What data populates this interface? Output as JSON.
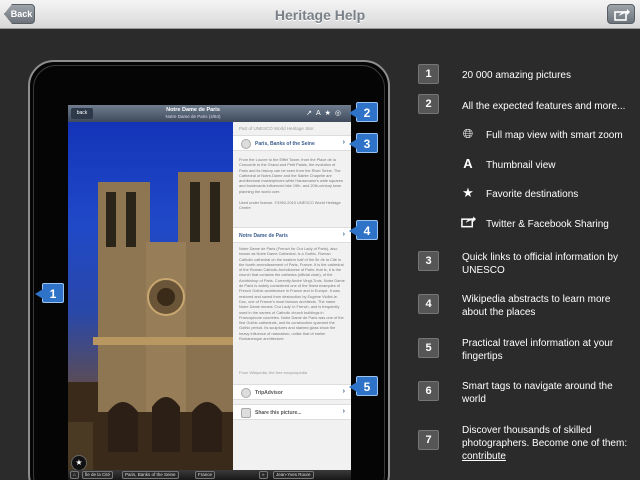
{
  "nav": {
    "back_label": "Back",
    "title": "Heritage Help"
  },
  "app": {
    "back_label": "back",
    "title": "Notre Dame de Paris",
    "subtitle": "Notre Dame de Paris (4/84)",
    "panel": {
      "heading": "Part of UNESCO World Heritage Site:",
      "unesco_label": "Paris, Banks of the Seine",
      "unesco_text": "From the Louvre to the Eiffel Tower, from the Place de la Concorde to the Grand and Petit Palais, the evolution of Paris and its history can be seen from the River Seine. The Cathedral of Notre-Dame and the Sainte Chapelle are architectural masterpieces while Haussmann's wide squares and boulevards influenced late 19th- and 20th-century town planning the world over.",
      "unesco_license": "Used under license. ©1992-2010 UNESCO World Heritage Centre",
      "wiki_label": "Notre Dame de Paris",
      "wiki_text": "Notre Dame de Paris (French for Our Lady of Paris), also known as Notre Dame Cathedral, is a Gothic, Roman Catholic cathedral on the eastern half of the Île de la Cité in the fourth arrondissement of Paris, France. It is the cathedral of the Roman Catholic Archdiocese of Paris: that is, it is the church that contains the cathedra (official chair), of the Archbishop of Paris. Currently André Vingt-Trois. Notre Dame de Paris is widely considered one of the finest examples of French Gothic architecture in France and in Europe. It was restored and saved from destruction by Eugène Viollet-le-Duc, one of France's most famous architects. The name Notre Dame means 'Our Lady' in French, and is frequently used in the names of Catholic church buildings in Francophone countries. Notre Dame de Paris was one of the first Gothic cathedrals, and its construction spanned the Gothic period. Its sculptures and stained glass show the heavy influence of naturalism, unlike that of earlier Romanesque architecture.",
      "wiki_source": "From Wikipedia, the free encyclopedia",
      "tripadvisor_label": "TripAdvisor",
      "share_label": "Share this picture..."
    },
    "crumbs": [
      "Île de la Cité",
      "Paris, Banks of the Seine",
      "France"
    ],
    "photographer": "Jean-Yves Roure"
  },
  "markers": [
    "1",
    "2",
    "3",
    "4",
    "5"
  ],
  "features": [
    {
      "num": "1",
      "text": "20 000 amazing pictures"
    },
    {
      "num": "2",
      "text": "All the expected features and more..."
    },
    {
      "num": "3",
      "text": "Quick links to official information by UNESCO"
    },
    {
      "num": "4",
      "text": "Wikipedia abstracts to learn more about the places"
    },
    {
      "num": "5",
      "text": "Practical travel information at your fingertips"
    },
    {
      "num": "6",
      "text": "Smart tags to navigate around the world"
    },
    {
      "num": "7",
      "text": "Discover thousands of skilled photographers. Become one of them:",
      "link": "contribute"
    }
  ],
  "sub_features": [
    {
      "icon": "globe-icon",
      "text": "Full map view with smart zoom"
    },
    {
      "icon": "thumbnail-icon",
      "text": "Thumbnail view"
    },
    {
      "icon": "star-icon",
      "text": "Favorite destinations"
    },
    {
      "icon": "share-icon",
      "text": "Twitter & Facebook Sharing"
    }
  ]
}
